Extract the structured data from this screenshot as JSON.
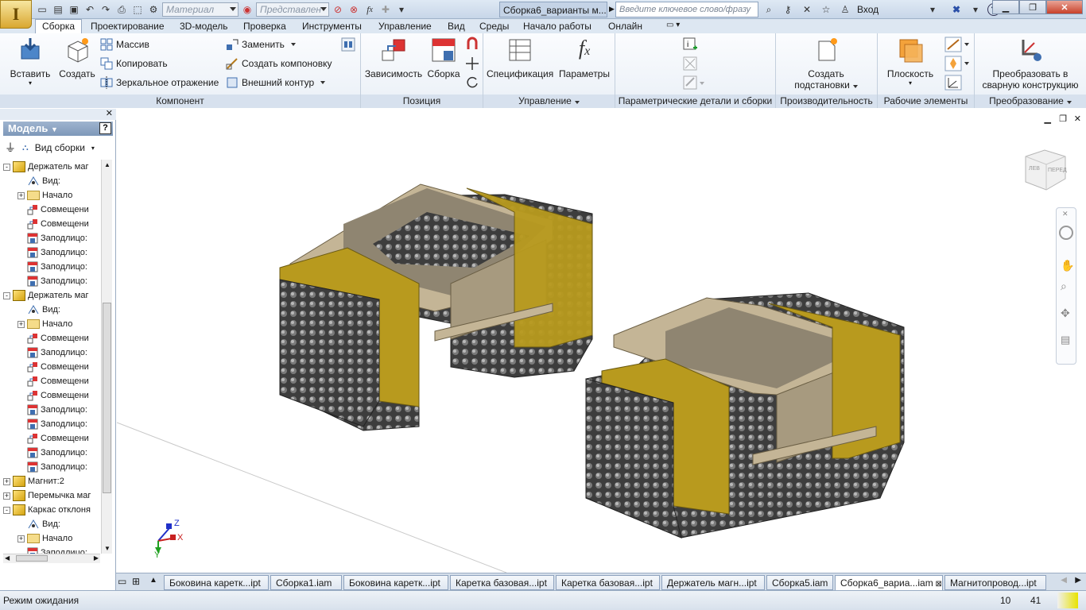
{
  "app_button_glyph": "I",
  "quick_access": {
    "material_placeholder": "Материал",
    "representation_placeholder": "Представлен",
    "document_title": "Сборка6_варианты м...",
    "search_placeholder": "Введите ключевое слово/фразу",
    "sign_in": "Вход"
  },
  "ribbon_tabs": [
    "Сборка",
    "Проектирование",
    "3D-модель",
    "Проверка",
    "Инструменты",
    "Управление",
    "Вид",
    "Среды",
    "Начало работы",
    "Онлайн"
  ],
  "ribbon": {
    "component": {
      "label": "Компонент",
      "insert": "Вставить",
      "create": "Создать",
      "pattern": "Массив",
      "copy": "Копировать",
      "mirror": "Зеркальное отражение",
      "replace": "Заменить",
      "create_layout": "Создать компоновку",
      "shrinkwrap": "Внешний контур"
    },
    "position": {
      "label": "Позиция",
      "constrain": "Зависимость",
      "assemble": "Сборка"
    },
    "manage": {
      "label": "Управление",
      "bom": "Спецификация",
      "parameters": "Параметры"
    },
    "ipart": {
      "label": "Параметрические детали и сборки"
    },
    "productivity": {
      "label": "Производительность",
      "create_substitute_l1": "Создать",
      "create_substitute_l2": "подстановки"
    },
    "work_features": {
      "label": "Рабочие элементы",
      "plane": "Плоскость"
    },
    "convert": {
      "label": "Преобразование",
      "weldment_l1": "Преобразовать в",
      "weldment_l2": "сварную конструкцию"
    }
  },
  "browser": {
    "title": "Модель",
    "view_label": "Вид сборки",
    "tree": [
      {
        "level": 0,
        "icon": "asm",
        "expander": "-",
        "label": "Держатель маг"
      },
      {
        "level": 1,
        "icon": "view",
        "expander": "",
        "label": "Вид:"
      },
      {
        "level": 1,
        "icon": "folder",
        "expander": "+",
        "label": "Начало"
      },
      {
        "level": 1,
        "icon": "mate",
        "expander": "",
        "label": "Совмещени"
      },
      {
        "level": 1,
        "icon": "mate",
        "expander": "",
        "label": "Совмещени"
      },
      {
        "level": 1,
        "icon": "flush",
        "expander": "",
        "label": "Заподлицо:"
      },
      {
        "level": 1,
        "icon": "flush",
        "expander": "",
        "label": "Заподлицо:"
      },
      {
        "level": 1,
        "icon": "flush",
        "expander": "",
        "label": "Заподлицо:"
      },
      {
        "level": 1,
        "icon": "flush",
        "expander": "",
        "label": "Заподлицо:"
      },
      {
        "level": 0,
        "icon": "asm",
        "expander": "-",
        "label": "Держатель маг"
      },
      {
        "level": 1,
        "icon": "view",
        "expander": "",
        "label": "Вид:"
      },
      {
        "level": 1,
        "icon": "folder",
        "expander": "+",
        "label": "Начало"
      },
      {
        "level": 1,
        "icon": "mate",
        "expander": "",
        "label": "Совмещени"
      },
      {
        "level": 1,
        "icon": "flush",
        "expander": "",
        "label": "Заподлицо:"
      },
      {
        "level": 1,
        "icon": "mate",
        "expander": "",
        "label": "Совмещени"
      },
      {
        "level": 1,
        "icon": "mate",
        "expander": "",
        "label": "Совмещени"
      },
      {
        "level": 1,
        "icon": "mate",
        "expander": "",
        "label": "Совмещени"
      },
      {
        "level": 1,
        "icon": "flush",
        "expander": "",
        "label": "Заподлицо:"
      },
      {
        "level": 1,
        "icon": "flush",
        "expander": "",
        "label": "Заподлицо:"
      },
      {
        "level": 1,
        "icon": "mate",
        "expander": "",
        "label": "Совмещени"
      },
      {
        "level": 1,
        "icon": "flush",
        "expander": "",
        "label": "Заподлицо:"
      },
      {
        "level": 1,
        "icon": "flush",
        "expander": "",
        "label": "Заподлицо:"
      },
      {
        "level": 0,
        "icon": "asm",
        "expander": "+",
        "label": "Магнит:2"
      },
      {
        "level": 0,
        "icon": "asm",
        "expander": "+",
        "label": "Перемычка маг"
      },
      {
        "level": 0,
        "icon": "asm",
        "expander": "-",
        "label": "Каркас отклоня"
      },
      {
        "level": 1,
        "icon": "view",
        "expander": "",
        "label": "Вид:"
      },
      {
        "level": 1,
        "icon": "folder",
        "expander": "+",
        "label": "Начало"
      },
      {
        "level": 1,
        "icon": "flush",
        "expander": "",
        "label": "Заподлицо:"
      }
    ]
  },
  "document_tabs": [
    {
      "label": "Боковина каретк...ipt",
      "active": false
    },
    {
      "label": "Сборка1.iam",
      "active": false
    },
    {
      "label": "Боковина каретк...ipt",
      "active": false
    },
    {
      "label": "Каретка базовая...ipt",
      "active": false
    },
    {
      "label": "Каретка базовая...ipt",
      "active": false
    },
    {
      "label": "Держатель магн...ipt",
      "active": false
    },
    {
      "label": "Сборка5.iam",
      "active": false
    },
    {
      "label": "Сборка6_вариа...iam",
      "active": true
    },
    {
      "label": "Магнитопровод...ipt",
      "active": false
    }
  ],
  "viewcube": {
    "left_face": "ЛЕВ",
    "front_face": "ПЕРЕД"
  },
  "triad": {
    "x": "X",
    "y": "Y",
    "z": "Z"
  },
  "status": {
    "text": "Режим ожидания",
    "count1": "10",
    "count2": "41"
  },
  "colors": {
    "accent": "#3f6fb0",
    "ribbon_label_bg": "#d7e1ee",
    "mesh_dark": "#3b3b3b",
    "beige": "#c4b596",
    "gold": "#b89a1e"
  }
}
